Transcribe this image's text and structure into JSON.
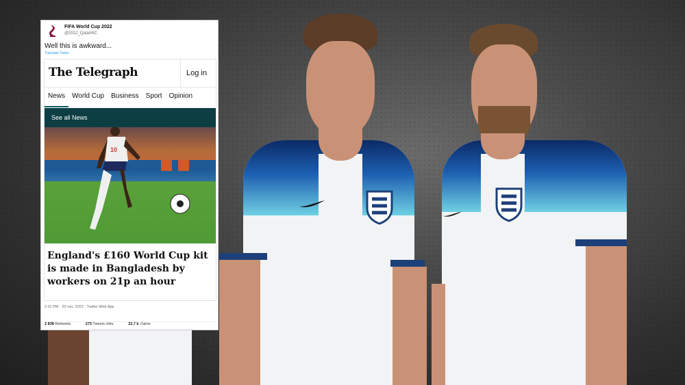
{
  "tweet": {
    "account_name": "FIFA World Cup 2022",
    "handle": "@2022_QatarWC",
    "text": "Well this is awkward...",
    "translate": "Translate Tweet",
    "meta": "2:31 PM · 20 nov. 2022 · Twitter Web App",
    "retweets_count": "2 838",
    "retweets_label": "Retweets",
    "quotes_count": "273",
    "quotes_label": "Tweets cités",
    "likes_count": "22,7 k",
    "likes_label": "J'aime"
  },
  "article": {
    "publisher": "The Telegraph",
    "login": "Log in",
    "nav": [
      "News",
      "World Cup",
      "Business",
      "Sport",
      "Opinion"
    ],
    "active_nav": "News",
    "see_all": "See all News",
    "headline": "England's £160 World Cup kit is made in Bangladesh by workers on 21p an hour",
    "photo_shirt_number": "10"
  },
  "colors": {
    "telegraph_bar": "#0d3e44",
    "kit_blue": "#1d5fb0",
    "kit_white": "#f2f3f5"
  }
}
